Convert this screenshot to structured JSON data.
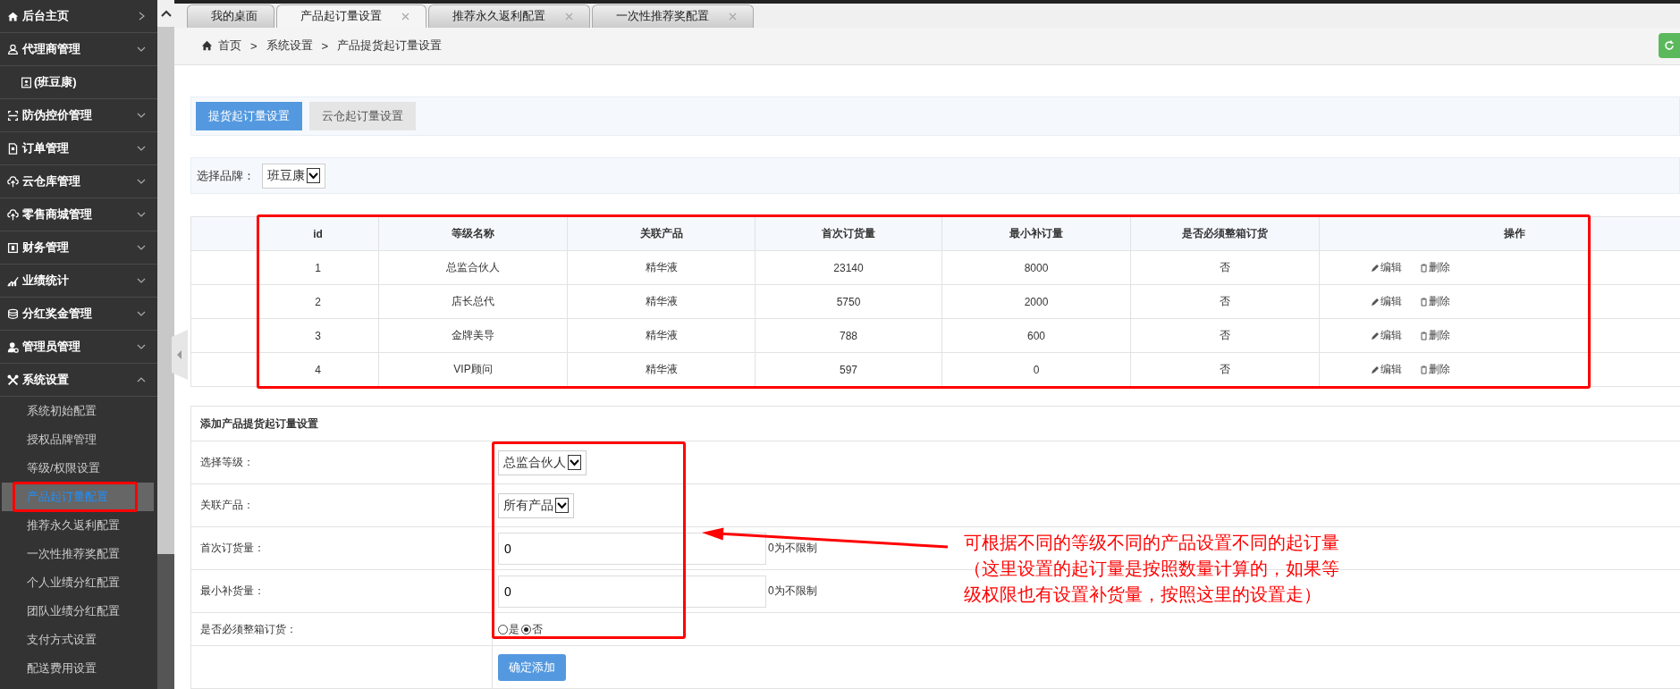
{
  "sidebar": {
    "items": [
      {
        "kind": "link",
        "label": "后台主页"
      },
      {
        "kind": "group",
        "label": "代理商管理",
        "expanded": false,
        "children": [
          {
            "kind": "agent",
            "label": "(班豆康)",
            "selected": false
          }
        ]
      },
      {
        "kind": "group",
        "label": "防伪控价管理",
        "expanded": false
      },
      {
        "kind": "group",
        "label": "订单管理",
        "expanded": false
      },
      {
        "kind": "group",
        "label": "云仓库管理",
        "expanded": false
      },
      {
        "kind": "group",
        "label": "零售商城管理",
        "expanded": false
      },
      {
        "kind": "group",
        "label": "财务管理",
        "expanded": false
      },
      {
        "kind": "group",
        "label": "业绩统计",
        "expanded": false
      },
      {
        "kind": "group",
        "label": "分红奖金管理",
        "expanded": false
      },
      {
        "kind": "group",
        "label": "管理员管理",
        "expanded": false
      },
      {
        "kind": "group",
        "label": "系统设置",
        "expanded": true,
        "children": [
          {
            "kind": "page",
            "label": "系统初始配置",
            "selected": false
          },
          {
            "kind": "page",
            "label": "授权品牌管理",
            "selected": false
          },
          {
            "kind": "page",
            "label": "等级/权限设置",
            "selected": false
          },
          {
            "kind": "page",
            "label": "产品起订量配置",
            "selected": true
          },
          {
            "kind": "page",
            "label": "推荐永久返利配置",
            "selected": false
          },
          {
            "kind": "page",
            "label": "一次性推荐奖配置",
            "selected": false
          },
          {
            "kind": "page",
            "label": "个人业绩分红配置",
            "selected": false
          },
          {
            "kind": "page",
            "label": "团队业绩分红配置",
            "selected": false
          },
          {
            "kind": "page",
            "label": "支付方式设置",
            "selected": false
          },
          {
            "kind": "page",
            "label": "配送费用设置",
            "selected": false
          }
        ]
      }
    ]
  },
  "tabs": [
    {
      "label": "我的桌面",
      "selected": false,
      "closable": false
    },
    {
      "label": "产品起订量设置",
      "selected": true,
      "closable": true
    },
    {
      "label": "推荐永久返利配置",
      "selected": false,
      "closable": true
    },
    {
      "label": "一次性推荐奖配置",
      "selected": false,
      "closable": true
    }
  ],
  "breadcrumb": [
    {
      "kind": "home",
      "label": "首页"
    },
    {
      "kind": "sep",
      "label": ">"
    },
    {
      "kind": "link",
      "label": "系统设置"
    },
    {
      "kind": "sep",
      "label": ">"
    },
    {
      "kind": "current",
      "label": "产品提货起订量设置"
    }
  ],
  "subtabs": [
    {
      "label": "提货起订量设置",
      "selected": true
    },
    {
      "label": "云仓起订量设置",
      "selected": false
    }
  ],
  "brand_filter": {
    "label": "选择品牌：",
    "value": "班豆康"
  },
  "table": {
    "columns": [
      "id",
      "等级名称",
      "关联产品",
      "首次订货量",
      "最小补订量",
      "是否必须整箱订货",
      "操作"
    ],
    "rows": [
      {
        "cells": [
          "1",
          "总监合伙人",
          "精华液",
          "23140",
          "8000",
          "否"
        ],
        "actions": [
          {
            "kind": "edit",
            "label": "编辑"
          },
          {
            "kind": "delete",
            "label": "删除"
          }
        ]
      },
      {
        "cells": [
          "2",
          "店长总代",
          "精华液",
          "5750",
          "2000",
          "否"
        ],
        "actions": [
          {
            "kind": "edit",
            "label": "编辑"
          },
          {
            "kind": "delete",
            "label": "删除"
          }
        ]
      },
      {
        "cells": [
          "3",
          "金牌美导",
          "精华液",
          "788",
          "600",
          "否"
        ],
        "actions": [
          {
            "kind": "edit",
            "label": "编辑"
          },
          {
            "kind": "delete",
            "label": "删除"
          }
        ]
      },
      {
        "cells": [
          "4",
          "VIP顾问",
          "精华液",
          "597",
          "0",
          "否"
        ],
        "actions": [
          {
            "kind": "edit",
            "label": "编辑"
          },
          {
            "kind": "delete",
            "label": "删除"
          }
        ]
      }
    ]
  },
  "form": {
    "title": "添加产品提货起订量设置",
    "rows": [
      {
        "kind": "select",
        "label": "选择等级：",
        "value": "总监合伙人"
      },
      {
        "kind": "select",
        "label": "关联产品：",
        "value": "所有产品"
      },
      {
        "kind": "input",
        "label": "首次订货量：",
        "value": "0",
        "hint": "0为不限制"
      },
      {
        "kind": "input",
        "label": "最小补货量：",
        "value": "0",
        "hint": "0为不限制"
      },
      {
        "kind": "radio",
        "label": "是否必须整箱订货：",
        "options": [
          {
            "label": "是",
            "selected": false
          },
          {
            "label": "否",
            "selected": true
          }
        ]
      }
    ],
    "submit": "确定添加"
  },
  "annotation": {
    "text": "可根据不同的等级不同的产品设置不同的起订量（这里设置的起订量是按照数量计算的，如果等级权限也有设置补货量，按照这里的设置走）"
  }
}
